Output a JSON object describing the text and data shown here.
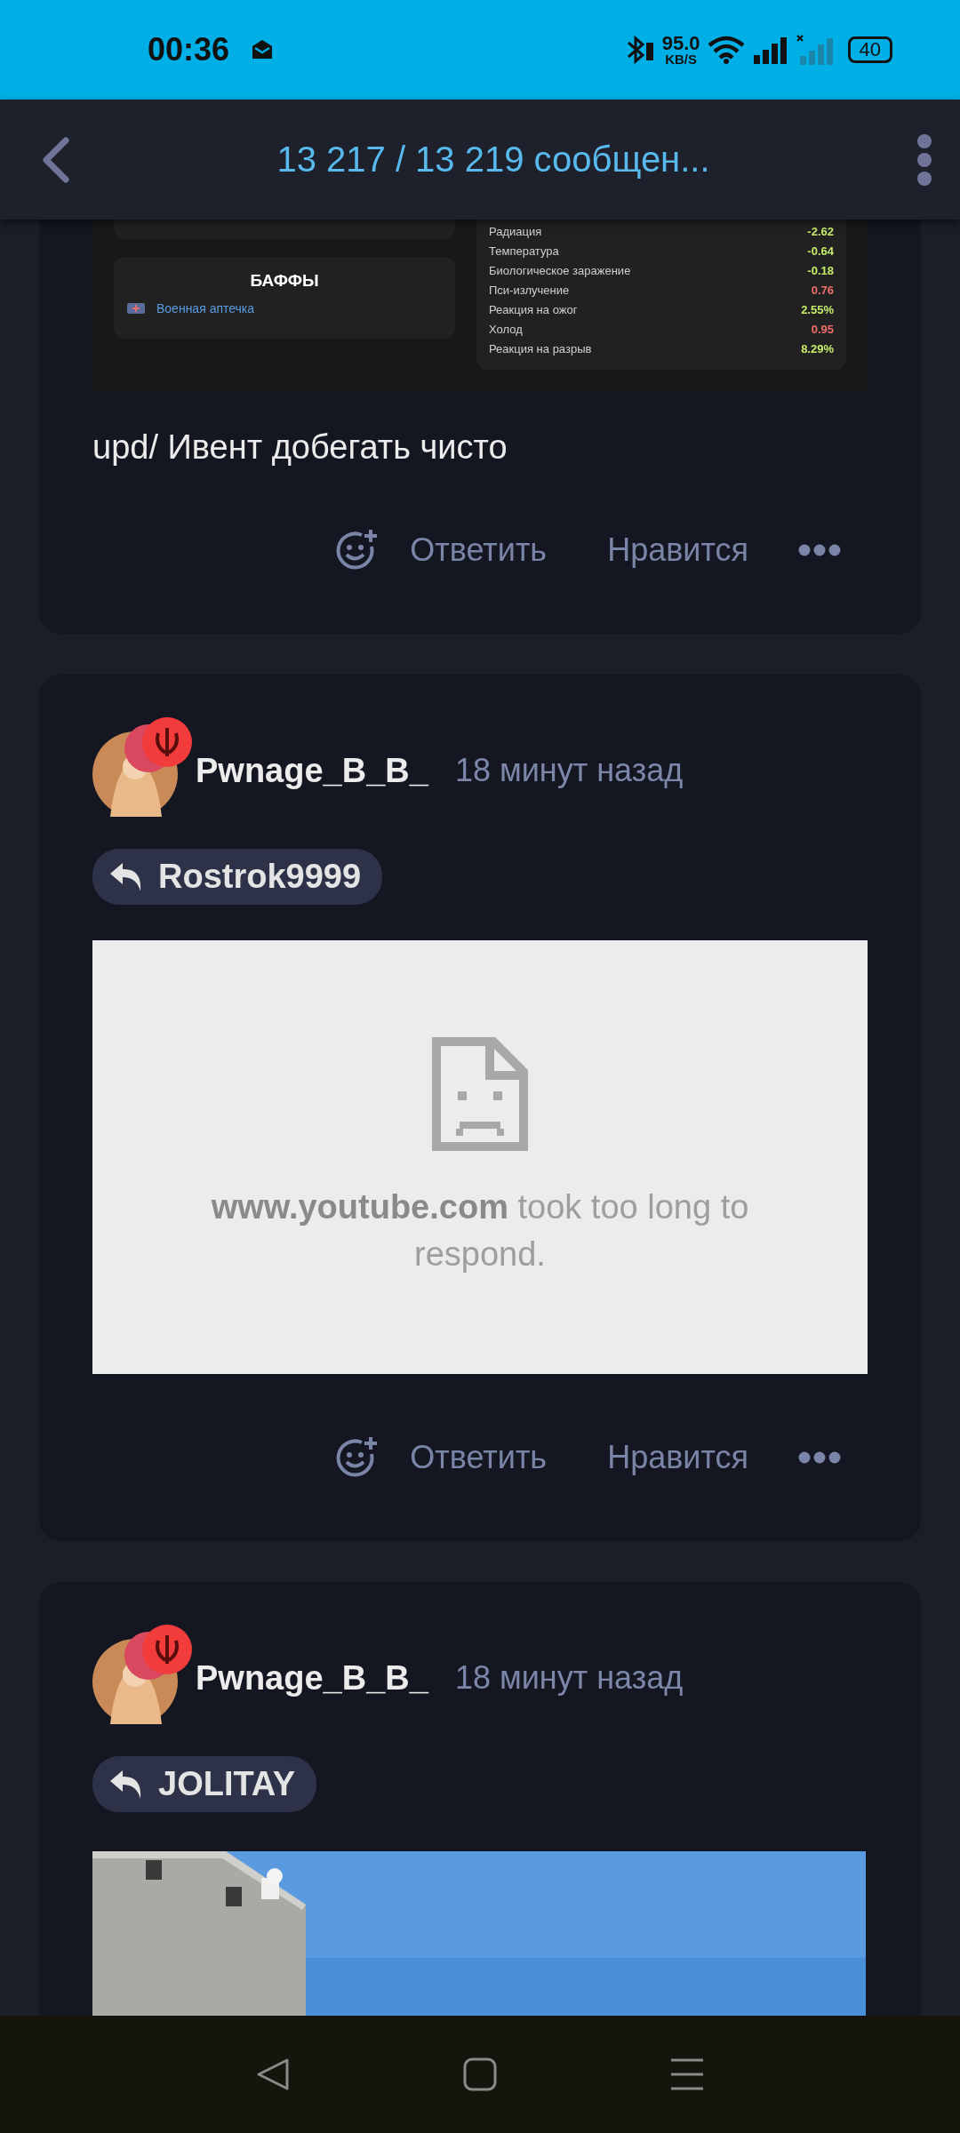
{
  "status_bar": {
    "time": "00:36",
    "net_speed": "95.0",
    "net_unit": "KB/S",
    "battery": "40"
  },
  "header": {
    "title": "13 217 / 13 219 сообщен..."
  },
  "posts": [
    {
      "kind": "screenshot",
      "screenshot": {
        "buffs_title": "БАФФЫ",
        "buffs": [
          "Военная аптечка"
        ],
        "stats": [
          {
            "name": "Радиация",
            "value": "-2.62",
            "color": "#c5ec6a"
          },
          {
            "name": "Температура",
            "value": "-0.64",
            "color": "#c5ec6a"
          },
          {
            "name": "Биологическое заражение",
            "value": "-0.18",
            "color": "#c5ec6a"
          },
          {
            "name": "Пси-излучение",
            "value": "0.76",
            "color": "#ee6f6a"
          },
          {
            "name": "Реакция на ожог",
            "value": "2.55%",
            "color": "#c5ec6a"
          },
          {
            "name": "Холод",
            "value": "0.95",
            "color": "#ee6f6a"
          },
          {
            "name": "Реакция на разрыв",
            "value": "8.29%",
            "color": "#c5ec6a"
          }
        ]
      },
      "text": "upd/ Ивент добегать чисто",
      "actions": [
        "Ответить",
        "Нравится"
      ]
    },
    {
      "kind": "error",
      "author": "Pwnage_B_B_",
      "time": "18 минут назад",
      "reply_to": "Rostrok9999",
      "error": "**www.youtube.com** took too long to respond.",
      "actions": [
        "Ответить",
        "Нравится"
      ]
    },
    {
      "kind": "picture",
      "author": "Pwnage_B_B_",
      "time": "18 минут назад",
      "reply_to": "JOLITAY"
    }
  ]
}
